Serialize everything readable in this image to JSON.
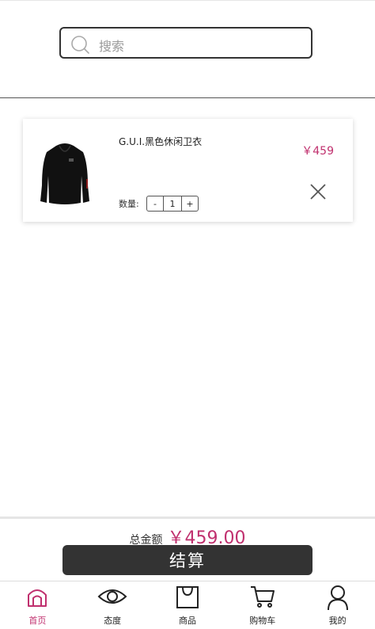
{
  "search": {
    "placeholder": "搜索"
  },
  "cart": {
    "items": [
      {
        "name": "G.U.I.黑色休闲卫衣",
        "price": "￥459",
        "quantity_label": "数量:",
        "minus": "-",
        "quantity": "1",
        "plus": "+"
      }
    ]
  },
  "summary": {
    "total_label": "总金额",
    "total_amount": "￥459.00",
    "checkout_label": "结算"
  },
  "tabbar": {
    "tabs": [
      {
        "label": "首页",
        "icon": "home-icon",
        "active": true
      },
      {
        "label": "态度",
        "icon": "eye-icon",
        "active": false
      },
      {
        "label": "商品",
        "icon": "shopping-bag-icon",
        "active": false
      },
      {
        "label": "购物车",
        "icon": "cart-icon",
        "active": false
      },
      {
        "label": "我的",
        "icon": "user-icon",
        "active": false
      }
    ]
  },
  "colors": {
    "accent": "#c0306e",
    "button_bg": "#333333"
  }
}
